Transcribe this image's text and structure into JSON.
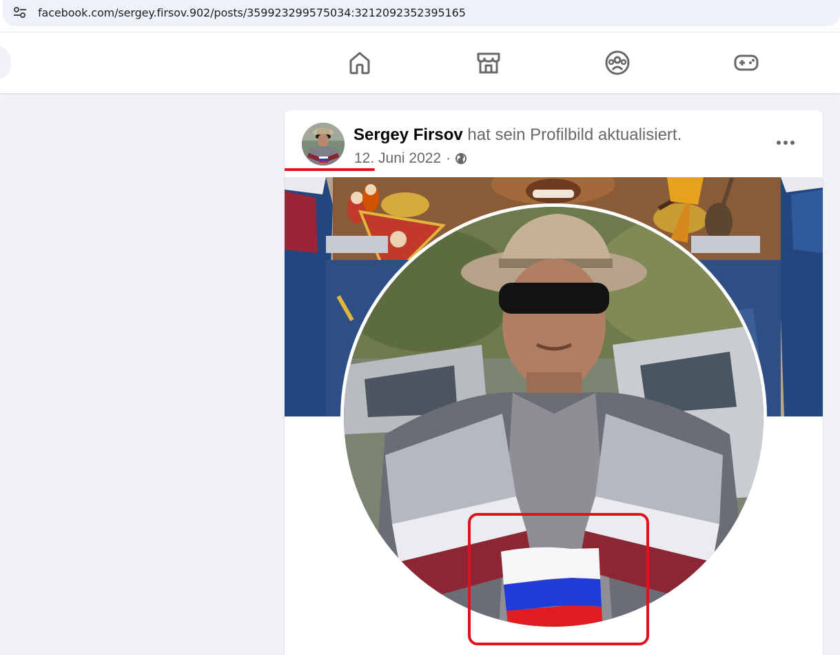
{
  "browser": {
    "url": "facebook.com/sergey.firsov.902/posts/3599232995750​34:3212092352395165",
    "site_settings_icon": "tune-icon"
  },
  "nav": {
    "icons": [
      "home-icon",
      "marketplace-icon",
      "groups-icon",
      "gaming-icon"
    ],
    "accent_color": "#65676b"
  },
  "post": {
    "author": "Sergey Firsov",
    "action": "hat sein Profilbild aktualisiert.",
    "date": "12. Juni 2022",
    "separator": "·",
    "privacy_icon": "globe-icon",
    "menu_icon": "more-options-icon"
  },
  "annotations": {
    "highlight_color": "#e0121c"
  }
}
